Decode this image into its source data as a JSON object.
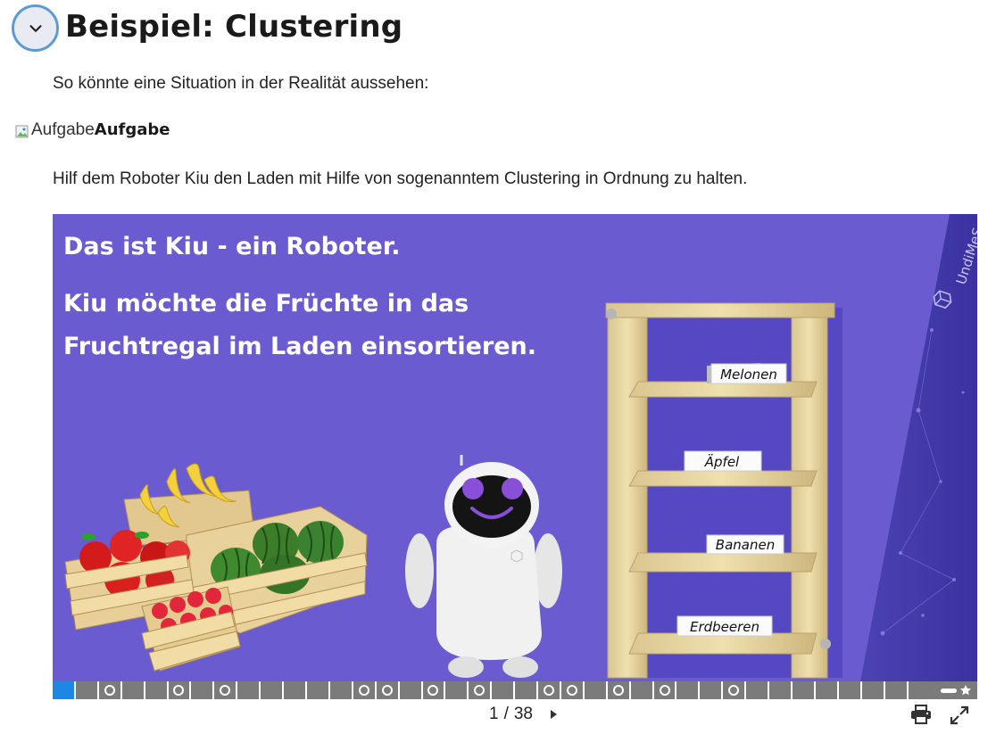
{
  "header": {
    "title": "Beispiel: Clustering"
  },
  "intro_text": "So könnte eine Situation in der Realität aussehen:",
  "aufgabe": {
    "img_alt": "Aufgabe",
    "label": "Aufgabe"
  },
  "task_text": "Hilf dem Roboter Kiu den Laden mit Hilfe von sogenanntem Clustering in Ordnung zu halten.",
  "slide": {
    "heading": "Das ist Kiu - ein Roboter.",
    "body": "Kiu möchte die Früchte in das Fruchtregal im Laden einsortieren.",
    "brand": "UndiMeS",
    "shelf_labels": [
      "Melonen",
      "Äpfel",
      "Bananen",
      "Erdbeeren"
    ]
  },
  "navigation": {
    "current": "1",
    "separator": "/",
    "total": "38"
  },
  "colors": {
    "slide_bg": "#6a5bd1",
    "progress_active": "#1e87e5",
    "toggle_border": "#5b9bd5"
  },
  "icons": [
    "chevron-down-icon",
    "broken-image-icon",
    "next-arrow-icon",
    "print-icon",
    "fullscreen-icon",
    "bookmark-star-icon"
  ]
}
